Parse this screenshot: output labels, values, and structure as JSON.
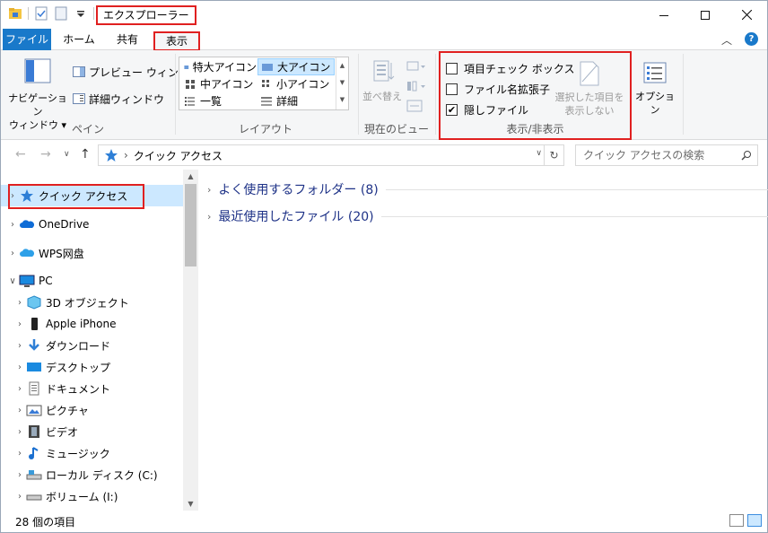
{
  "titlebar": {
    "title": "エクスプローラー",
    "icons": [
      "folder-icon",
      "properties-icon",
      "new-folder-icon",
      "customize-arrow-icon"
    ]
  },
  "window_buttons": [
    "minimize-icon",
    "maximize-icon",
    "close-icon"
  ],
  "tabs": [
    {
      "label": "ファイル",
      "active": false
    },
    {
      "label": "ホーム",
      "active": false
    },
    {
      "label": "共有",
      "active": false
    },
    {
      "label": "表示",
      "active": true
    }
  ],
  "ribbon": {
    "pane": {
      "nav_pane_label_1": "ナビゲーション",
      "nav_pane_label_2": "ウィンドウ ▾",
      "preview_pane": "プレビュー ウィンドウ",
      "details_pane": "詳細ウィンドウ",
      "group_label": "ペイン"
    },
    "layout": {
      "items": [
        {
          "label": "特大アイコン",
          "selected": false
        },
        {
          "label": "大アイコン",
          "selected": true
        },
        {
          "label": "中アイコン",
          "selected": false
        },
        {
          "label": "小アイコン",
          "selected": false
        },
        {
          "label": "一覧",
          "selected": false
        },
        {
          "label": "詳細",
          "selected": false
        }
      ],
      "group_label": "レイアウト"
    },
    "current_view": {
      "sort_label": "並べ替え",
      "group_label": "現在のビュー"
    },
    "show_hide": {
      "item_checkboxes": {
        "label": "項目チェック ボックス",
        "checked": false
      },
      "file_extensions": {
        "label": "ファイル名拡張子",
        "checked": false
      },
      "hidden_items": {
        "label": "隠しファイル",
        "checked": true
      },
      "hide_selected_1": "選択した項目を",
      "hide_selected_2": "表示しない",
      "group_label": "表示/非表示"
    },
    "options_label": "オプション"
  },
  "address": {
    "path": "クイック アクセス",
    "search_placeholder": "クイック アクセスの検索"
  },
  "navigation": [
    {
      "label": "クイック アクセス",
      "icon": "star-icon",
      "selected": true
    },
    {
      "label": "OneDrive",
      "icon": "cloud-icon"
    },
    {
      "label": "WPS网盘",
      "icon": "cloud-icon"
    },
    {
      "label": "PC",
      "icon": "pc-icon",
      "expanded": true
    },
    {
      "label": "3D オブジェクト",
      "icon": "cube-icon"
    },
    {
      "label": "Apple iPhone",
      "icon": "phone-icon"
    },
    {
      "label": "ダウンロード",
      "icon": "download-icon"
    },
    {
      "label": "デスクトップ",
      "icon": "desktop-icon"
    },
    {
      "label": "ドキュメント",
      "icon": "document-icon"
    },
    {
      "label": "ピクチャ",
      "icon": "picture-icon"
    },
    {
      "label": "ビデオ",
      "icon": "video-icon"
    },
    {
      "label": "ミュージック",
      "icon": "music-icon"
    },
    {
      "label": "ローカル ディスク (C:)",
      "icon": "disk-icon"
    },
    {
      "label": "ボリューム (I:)",
      "icon": "drive-icon"
    }
  ],
  "content": {
    "groups": [
      {
        "label": "よく使用するフォルダー (8)"
      },
      {
        "label": "最近使用したファイル (20)"
      }
    ]
  },
  "status": {
    "count": "28 個の項目"
  },
  "colors": {
    "file_tab": "#1979ca",
    "highlight_border": "#e02020",
    "selection": "#cce8ff",
    "group_header": "#1e3287"
  }
}
